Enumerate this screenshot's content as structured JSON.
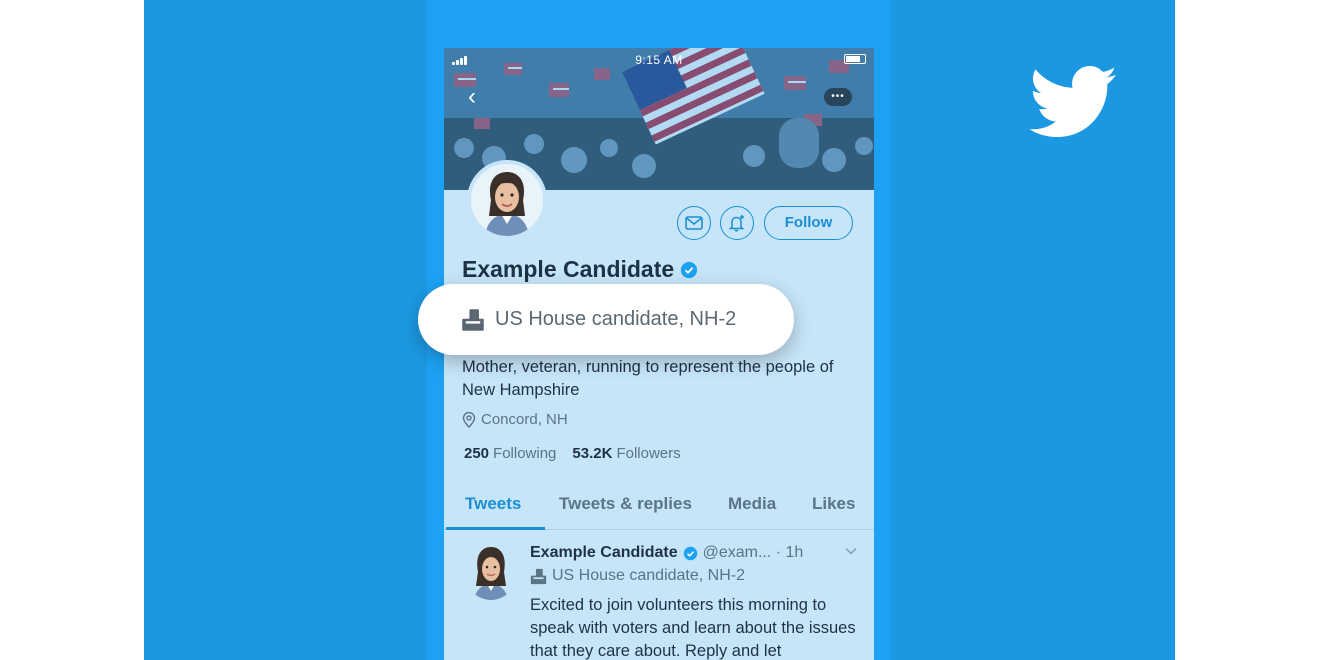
{
  "status_bar": {
    "time": "9:15 AM"
  },
  "profile": {
    "name": "Example Candidate",
    "label": "US House candidate, NH-2",
    "bio": "Mother, veteran, running to represent the people of New Hampshire",
    "location": "Concord, NH",
    "following_count": "250",
    "following_label": "Following",
    "followers_count": "53.2K",
    "followers_label": "Followers"
  },
  "actions": {
    "follow_label": "Follow"
  },
  "tabs": [
    {
      "label": "Tweets",
      "active": true
    },
    {
      "label": "Tweets & replies",
      "active": false
    },
    {
      "label": "Media",
      "active": false
    },
    {
      "label": "Likes",
      "active": false
    }
  ],
  "tweet": {
    "name": "Example Candidate",
    "meta": "@exam... · 1h",
    "label": "US House candidate, NH-2",
    "text": "Excited to join volunteers this morning to speak with voters and learn about the issues that they care about. Reply and let"
  },
  "colors": {
    "brand": "#1da1f2",
    "background": "#1c98e3",
    "accent": "#1b8ed4",
    "screen": "#c6e5f8"
  },
  "icons": [
    "twitter-bird-icon",
    "back-icon",
    "message-icon",
    "notification-bell-icon",
    "verified-badge-icon",
    "ballot-box-icon",
    "location-pin-icon",
    "chevron-down-icon"
  ]
}
